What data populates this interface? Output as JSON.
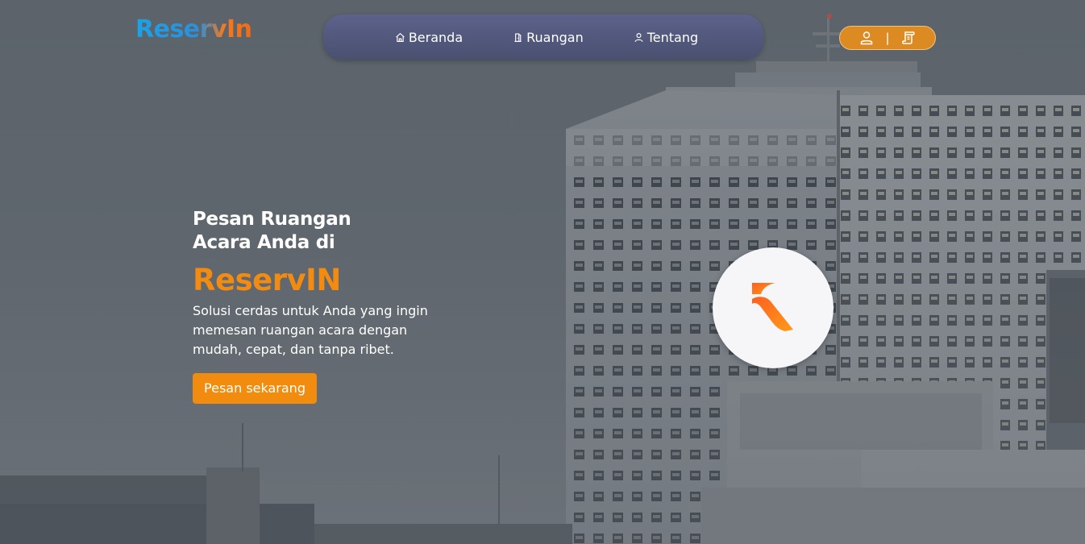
{
  "header": {
    "logo_text": "ReservIn",
    "nav": [
      {
        "label": "Beranda",
        "icon": "home-icon"
      },
      {
        "label": "Ruangan",
        "icon": "door-icon"
      },
      {
        "label": "Tentang",
        "icon": "user-icon"
      }
    ],
    "account": {
      "login_icon": "user-icon",
      "separator": "|",
      "register_icon": "scroll-icon"
    }
  },
  "hero": {
    "title": "Pesan Ruangan Acara Anda di",
    "brand": "ReservIN",
    "description": "Solusi cerdas untuk Anda yang ingin memesan ruangan acara dengan mudah, cepat, dan tanpa ribet.",
    "cta_label": "Pesan sekarang"
  },
  "colors": {
    "accent": "#f28c0e",
    "nav_bg": "#555b7e",
    "account_bg": "#dc8a22",
    "background": "#5f666d"
  }
}
